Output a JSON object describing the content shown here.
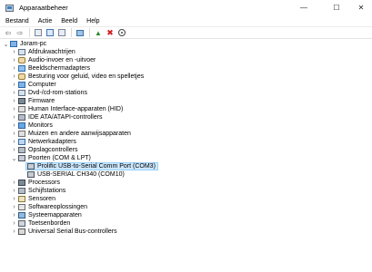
{
  "window": {
    "title": "Apparaatbeheer",
    "controls": {
      "minimize": "—",
      "maximize": "☐",
      "close": "✕"
    }
  },
  "menu": [
    "Bestand",
    "Actie",
    "Beeld",
    "Help"
  ],
  "toolbar": {
    "icons": [
      "back-icon",
      "forward-icon",
      "properties-icon",
      "help-icon",
      "show-hidden-icon",
      "scan-hardware-icon",
      "update-driver-icon",
      "uninstall-icon",
      "disable-icon"
    ],
    "back": "⇦",
    "forward": "⇨",
    "update": "▲",
    "remove": "✖"
  },
  "tree": {
    "root": "Joram-pc",
    "categories": [
      {
        "label": "Afdrukwachtrijen",
        "icon": "printer-queue-icon",
        "expanded": false
      },
      {
        "label": "Audio-invoer en -uitvoer",
        "icon": "audio-icon",
        "expanded": false
      },
      {
        "label": "Beeldschermadapters",
        "icon": "display-adapter-icon",
        "expanded": false
      },
      {
        "label": "Besturing voor geluid, video en spelletjes",
        "icon": "sound-video-icon",
        "expanded": false
      },
      {
        "label": "Computer",
        "icon": "computer-icon",
        "expanded": false
      },
      {
        "label": "Dvd-/cd-rom-stations",
        "icon": "dvd-drive-icon",
        "expanded": false
      },
      {
        "label": "Firmware",
        "icon": "firmware-icon",
        "expanded": false
      },
      {
        "label": "Human Interface-apparaten (HID)",
        "icon": "hid-icon",
        "expanded": false
      },
      {
        "label": "IDE ATA/ATAPI-controllers",
        "icon": "ide-controller-icon",
        "expanded": false
      },
      {
        "label": "Monitors",
        "icon": "monitor-icon",
        "expanded": false
      },
      {
        "label": "Muizen en andere aanwijsapparaten",
        "icon": "mouse-icon",
        "expanded": false
      },
      {
        "label": "Netwerkadapters",
        "icon": "network-adapter-icon",
        "expanded": false
      },
      {
        "label": "Opslagcontrollers",
        "icon": "storage-controller-icon",
        "expanded": false
      },
      {
        "label": "Poorten (COM & LPT)",
        "icon": "port-icon",
        "expanded": true,
        "children": [
          {
            "label": "Prolific USB-to-Serial Comm Port (COM3)",
            "icon": "serial-port-icon",
            "selected": true
          },
          {
            "label": "USB-SERIAL CH340 (COM10)",
            "icon": "serial-port-icon",
            "selected": false
          }
        ]
      },
      {
        "label": "Processors",
        "icon": "processor-icon",
        "expanded": false
      },
      {
        "label": "Schijfstations",
        "icon": "disk-drive-icon",
        "expanded": false
      },
      {
        "label": "Sensoren",
        "icon": "sensor-icon",
        "expanded": false
      },
      {
        "label": "Softwareoplossingen",
        "icon": "software-component-icon",
        "expanded": false
      },
      {
        "label": "Systeemapparaten",
        "icon": "system-device-icon",
        "expanded": false
      },
      {
        "label": "Toetsenborden",
        "icon": "keyboard-icon",
        "expanded": false
      },
      {
        "label": "Universal Serial Bus-controllers",
        "icon": "usb-controller-icon",
        "expanded": false
      }
    ]
  },
  "colors": {
    "selection_bg": "#cce8ff",
    "selection_border": "#99d1ff",
    "uninstall_red": "#d11f1f",
    "update_green": "#2f8a2f"
  }
}
